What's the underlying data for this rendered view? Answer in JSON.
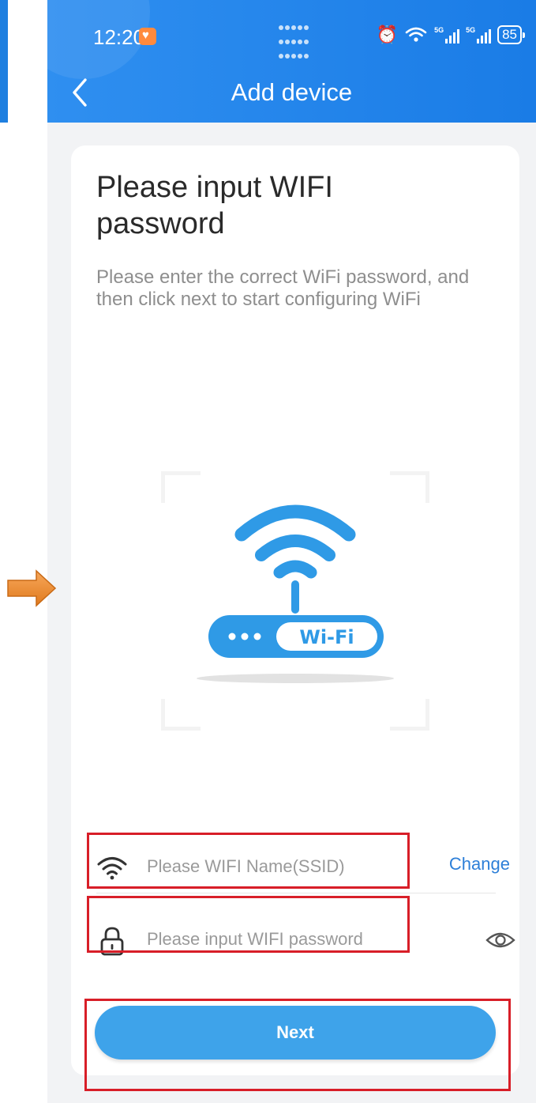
{
  "status_bar": {
    "time": "12:20",
    "battery": "85"
  },
  "header": {
    "title": "Add device",
    "back_icon": "chevron-left-icon"
  },
  "card": {
    "title": "Please input WIFI password",
    "description": "Please enter the correct WiFi password, and then click next to start configuring WiFi",
    "illustration": {
      "badge_text": "Wi-Fi"
    }
  },
  "form": {
    "ssid": {
      "icon": "wifi-icon",
      "placeholder": "Please WIFI Name(SSID)",
      "value": "",
      "action_label": "Change"
    },
    "password": {
      "icon": "lock-icon",
      "placeholder": "Please input WIFI password",
      "value": "",
      "toggle_icon": "eye-icon"
    },
    "next_label": "Next"
  },
  "colors": {
    "header_blue": "#1a7ce6",
    "accent_blue": "#3ea3ea",
    "link_blue": "#2d7fd8",
    "highlight_red": "#d81e28",
    "pointer_orange": "#f08a2e"
  }
}
